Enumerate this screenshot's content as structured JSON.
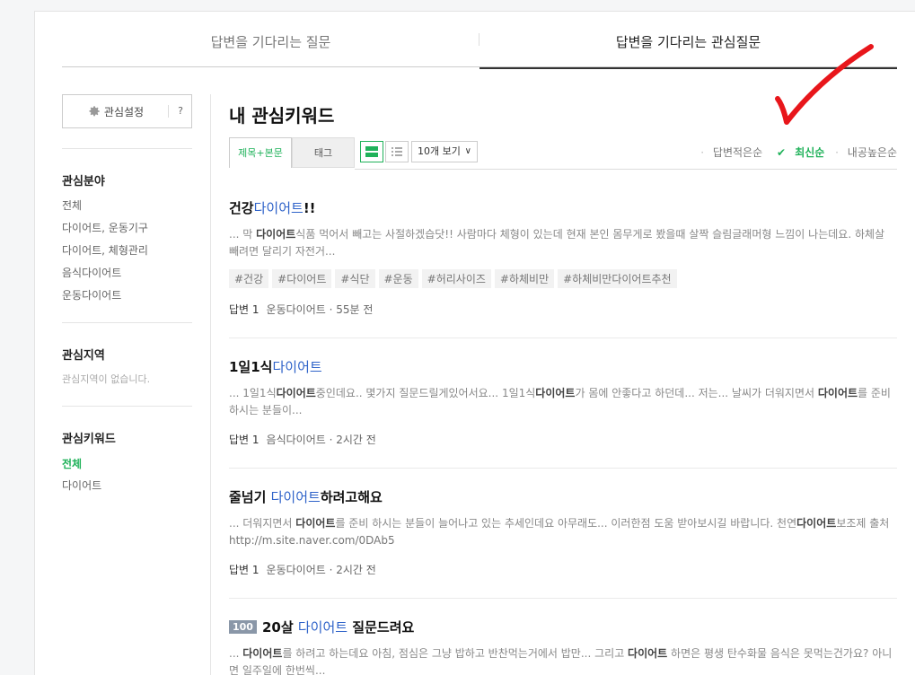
{
  "tabs": {
    "left": "답변을 기다리는 질문",
    "right": "답변을 기다리는 관심질문"
  },
  "sidebar": {
    "settings_label": "관심설정",
    "help_label": "?",
    "field_title": "관심분야",
    "fields": [
      "전체",
      "다이어트, 운동기구",
      "다이어트, 체형관리",
      "음식다이어트",
      "운동다이어트"
    ],
    "region_title": "관심지역",
    "region_empty": "관심지역이 없습니다.",
    "keyword_title": "관심키워드",
    "keywords": [
      "전체",
      "다이어트"
    ]
  },
  "main": {
    "title": "내 관심키워드",
    "filter_tabs": [
      "제목+본문",
      "태그"
    ],
    "per_page": "10개 보기",
    "sort": [
      "답변적은순",
      "최신순",
      "내공높은순"
    ],
    "sort_selected": "최신순"
  },
  "questions": [
    {
      "title_pre": "건강",
      "title_kw": "다이어트",
      "title_post": "!!",
      "snippet_html": "... 막 <b>다이어트</b>식품 먹어서 빼고는 사절하겠습닷!! 사람마다 체형이 있는데 현재 본인 몸무게로 봤을때 살짝 슬림글래머형 느낌이 나는데요. 하체살 빼려면 달리기 자전거...",
      "tags": [
        "#건강",
        "#다이어트",
        "#식단",
        "#운동",
        "#허리사이즈",
        "#하체비만",
        "#하체비만다이어트추천"
      ],
      "answers": "답변 1",
      "category": "운동다이어트",
      "time": "· 55분 전"
    },
    {
      "title_pre": "1일1식",
      "title_kw": "다이어트",
      "title_post": "",
      "snippet_html": "... 1일1식<b>다이어트</b>중인데요.. 몇가지 질문드릴게있어서요... 1일1식<b>다이어트</b>가 몸에 안좋다고 하던데... 저는... 날씨가 더워지면서 <b>다이어트</b>를 준비 하시는 분들이...",
      "tags": [],
      "answers": "답변 1",
      "category": "음식다이어트",
      "time": "· 2시간 전"
    },
    {
      "title_pre": "줄넘기 ",
      "title_kw": "다이어트",
      "title_post": "하려고해요",
      "snippet_html": "... 더워지면서 <b>다이어트</b>를 준비 하시는 분들이 늘어나고 있는 추세인데요 아무래도... 이러한점 도움 받아보시길 바랍니다. 천연<b>다이어트</b>보조제 출처 <span class=\"url\">http://m.site.naver.com/0DAb5</span>",
      "tags": [],
      "answers": "답변 1",
      "category": "운동다이어트",
      "time": "· 2시간 전"
    },
    {
      "badge": "100",
      "title_pre": "20살 ",
      "title_kw": "다이어트",
      "title_post": " 질문드려요",
      "snippet_html": "... <b>다이어트</b>를 하려고 하는데요 아침, 점심은 그냥 밥하고 반찬먹는거에서 밥만... 그리고 <b>다이어트</b> 하면은 평생 탄수화물 음식은 못먹는건가요? 아니면 일주일에 한번씩...",
      "tags": [],
      "answers": "",
      "category": "",
      "time": ""
    }
  ]
}
